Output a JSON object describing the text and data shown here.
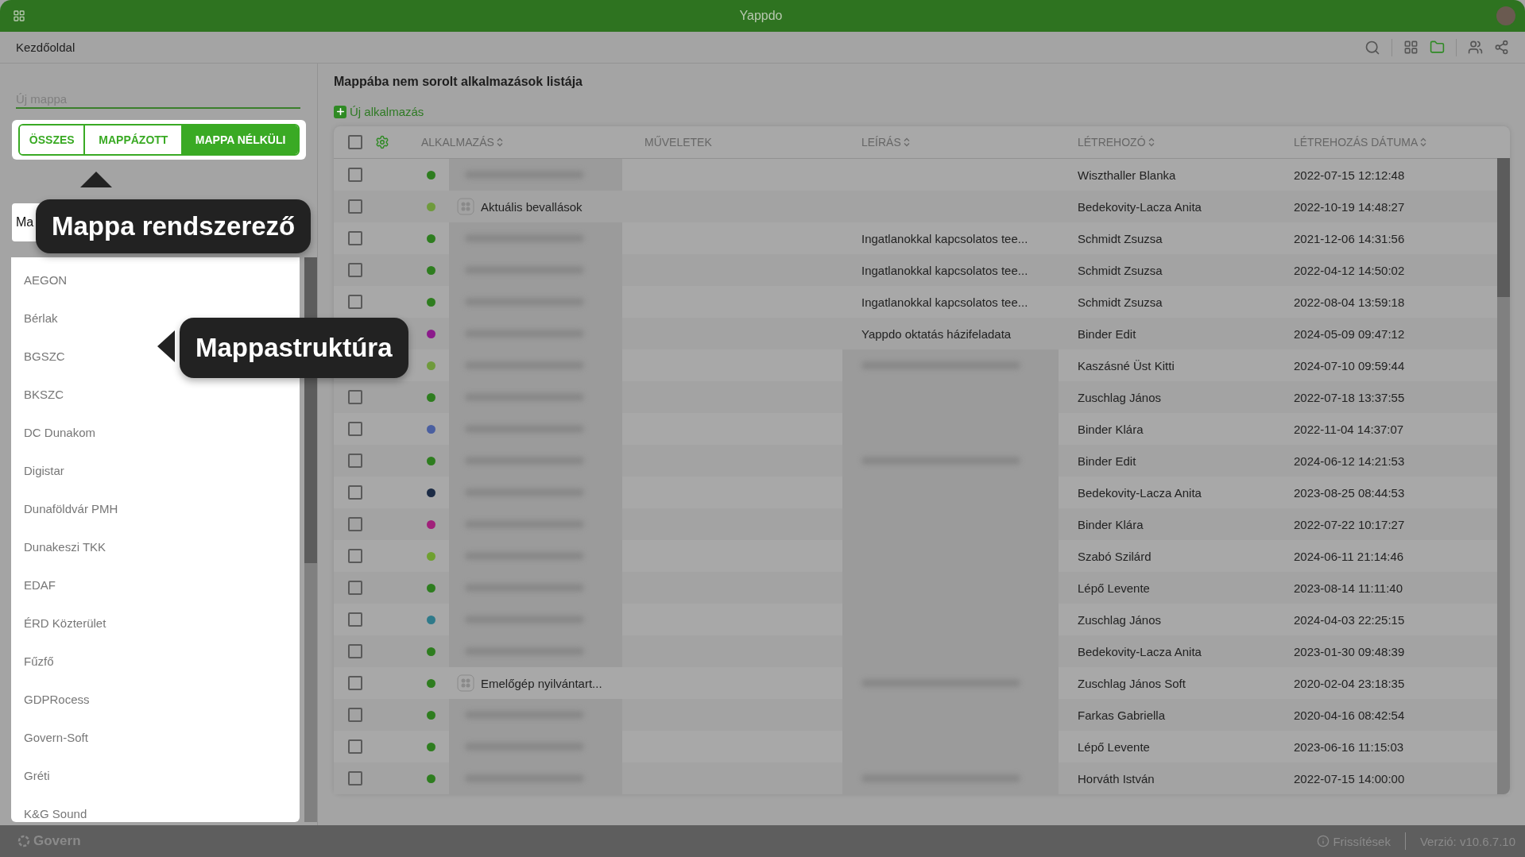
{
  "window": {
    "title": "Yappdo"
  },
  "toolbar": {
    "breadcrumb": "Kezdőoldal"
  },
  "sidebar": {
    "new_folder": {
      "placeholder": "Új mappa"
    },
    "filter_tabs": [
      {
        "label": "ÖSSZES",
        "selected": false
      },
      {
        "label": "MAPPÁZOTT",
        "selected": false
      },
      {
        "label": "MAPPA NÉLKÜLI",
        "selected": true
      }
    ],
    "folder_search": {
      "value": "Ma"
    },
    "folders": [
      "AEGON",
      "Bérlak",
      "BGSZC",
      "BKSZC",
      "DC Dunakom",
      "Digistar",
      "Dunaföldvár PMH",
      "Dunakeszi TKK",
      "EDAF",
      "ÉRD Közterület",
      "Fűzfő",
      "GDPRocess",
      "Govern-Soft",
      "Gréti",
      "K&G Sound"
    ]
  },
  "main": {
    "heading": "Mappába nem sorolt alkalmazások listája",
    "new_app_link": "Új alkalmazás",
    "table": {
      "select_all_checked": false,
      "columns": [
        {
          "label": "ALKALMAZÁS",
          "sortable": true
        },
        {
          "label": "MŰVELETEK",
          "sortable": false
        },
        {
          "label": "LEÍRÁS",
          "sortable": true
        },
        {
          "label": "LÉTREHOZÓ",
          "sortable": true
        },
        {
          "label": "LÉTREHOZÁS DÁTUMA",
          "sortable": true
        }
      ],
      "rows": [
        {
          "checked": false,
          "color": "#2e7d1f",
          "app": {
            "kind": "blurred"
          },
          "description": {
            "kind": "empty"
          },
          "creator": "Wiszthaller Blanka",
          "created": "2022-07-15 12:12:48"
        },
        {
          "checked": false,
          "color": "#6f9a3c",
          "app": {
            "kind": "text",
            "label": "Aktuális bevallások"
          },
          "description": {
            "kind": "empty"
          },
          "creator": "Bedekovity-Lacza Anita",
          "created": "2022-10-19 14:48:27"
        },
        {
          "checked": false,
          "color": "#2e7d1f",
          "app": {
            "kind": "blurred"
          },
          "description": {
            "kind": "text",
            "label": "Ingatlanokkal kapcsolatos tee..."
          },
          "creator": "Schmidt Zsuzsa",
          "created": "2021-12-06 14:31:56"
        },
        {
          "checked": false,
          "color": "#2e7d1f",
          "app": {
            "kind": "blurred"
          },
          "description": {
            "kind": "text",
            "label": "Ingatlanokkal kapcsolatos tee..."
          },
          "creator": "Schmidt Zsuzsa",
          "created": "2022-04-12 14:50:02"
        },
        {
          "checked": false,
          "color": "#2e7d1f",
          "app": {
            "kind": "blurred"
          },
          "description": {
            "kind": "text",
            "label": "Ingatlanokkal kapcsolatos tee..."
          },
          "creator": "Schmidt Zsuzsa",
          "created": "2022-08-04 13:59:18"
        },
        {
          "color": "#8b1a8b",
          "app": {
            "kind": "blurred"
          },
          "description": {
            "kind": "text",
            "label": "Yappdo oktatás házifeladata"
          },
          "creator": "Binder Edit",
          "created": "2024-05-09 09:47:12"
        },
        {
          "color": "#6f9a3c",
          "app": {
            "kind": "blurred"
          },
          "description": {
            "kind": "blurred"
          },
          "creator": "Kaszásné Üst Kitti",
          "created": "2024-07-10 09:59:44"
        },
        {
          "checked": false,
          "color": "#2e7d1f",
          "app": {
            "kind": "blurred"
          },
          "description": {
            "kind": "shaded"
          },
          "creator": "Zuschlag János",
          "created": "2022-07-18 13:37:55"
        },
        {
          "checked": false,
          "color": "#4a5fa0",
          "app": {
            "kind": "blurred"
          },
          "description": {
            "kind": "shaded"
          },
          "creator": "Binder Klára",
          "created": "2022-11-04 14:37:07"
        },
        {
          "checked": false,
          "color": "#2e7d1f",
          "app": {
            "kind": "blurred"
          },
          "description": {
            "kind": "blurred"
          },
          "creator": "Binder Edit",
          "created": "2024-06-12 14:21:53"
        },
        {
          "checked": false,
          "color": "#1c2b45",
          "app": {
            "kind": "blurred"
          },
          "description": {
            "kind": "shaded"
          },
          "creator": "Bedekovity-Lacza Anita",
          "created": "2023-08-25 08:44:53"
        },
        {
          "checked": false,
          "color": "#a0207a",
          "app": {
            "kind": "blurred"
          },
          "description": {
            "kind": "shaded"
          },
          "creator": "Binder Klára",
          "created": "2022-07-22 10:17:27"
        },
        {
          "checked": false,
          "color": "#6fa030",
          "app": {
            "kind": "blurred"
          },
          "description": {
            "kind": "shaded"
          },
          "creator": "Szabó Szilárd",
          "created": "2024-06-11 21:14:46"
        },
        {
          "checked": false,
          "color": "#2e7d1f",
          "app": {
            "kind": "blurred"
          },
          "description": {
            "kind": "shaded"
          },
          "creator": "Lépő Levente",
          "created": "2023-08-14 11:11:40"
        },
        {
          "checked": false,
          "color": "#2f7a8a",
          "app": {
            "kind": "blurred"
          },
          "description": {
            "kind": "shaded"
          },
          "creator": "Zuschlag János",
          "created": "2024-04-03 22:25:15"
        },
        {
          "checked": false,
          "color": "#2e7d1f",
          "app": {
            "kind": "blurred"
          },
          "description": {
            "kind": "shaded"
          },
          "creator": "Bedekovity-Lacza Anita",
          "created": "2023-01-30 09:48:39"
        },
        {
          "checked": false,
          "color": "#2e7d1f",
          "app": {
            "kind": "text",
            "label": "Emelőgép nyilvántart..."
          },
          "description": {
            "kind": "blurred"
          },
          "creator": "Zuschlag János Soft",
          "created": "2020-02-04 23:18:35"
        },
        {
          "checked": false,
          "color": "#2e7d1f",
          "app": {
            "kind": "blurred"
          },
          "description": {
            "kind": "shaded"
          },
          "creator": "Farkas Gabriella",
          "created": "2020-04-16 08:42:54"
        },
        {
          "checked": false,
          "color": "#2e7d1f",
          "app": {
            "kind": "blurred"
          },
          "description": {
            "kind": "shaded"
          },
          "creator": "Lépő Levente",
          "created": "2023-06-16 11:15:03"
        },
        {
          "checked": false,
          "color": "#2e7d1f",
          "app": {
            "kind": "blurred"
          },
          "description": {
            "kind": "blurred"
          },
          "creator": "Horváth István",
          "created": "2022-07-15 14:00:00"
        }
      ]
    }
  },
  "tooltips": [
    {
      "text": "Mappa rendszerező"
    },
    {
      "text": "Mappastruktúra"
    }
  ],
  "status_bar": {
    "brand": "Govern",
    "updates": "Frissítések",
    "version": "Verzió: v10.6.7.10"
  }
}
